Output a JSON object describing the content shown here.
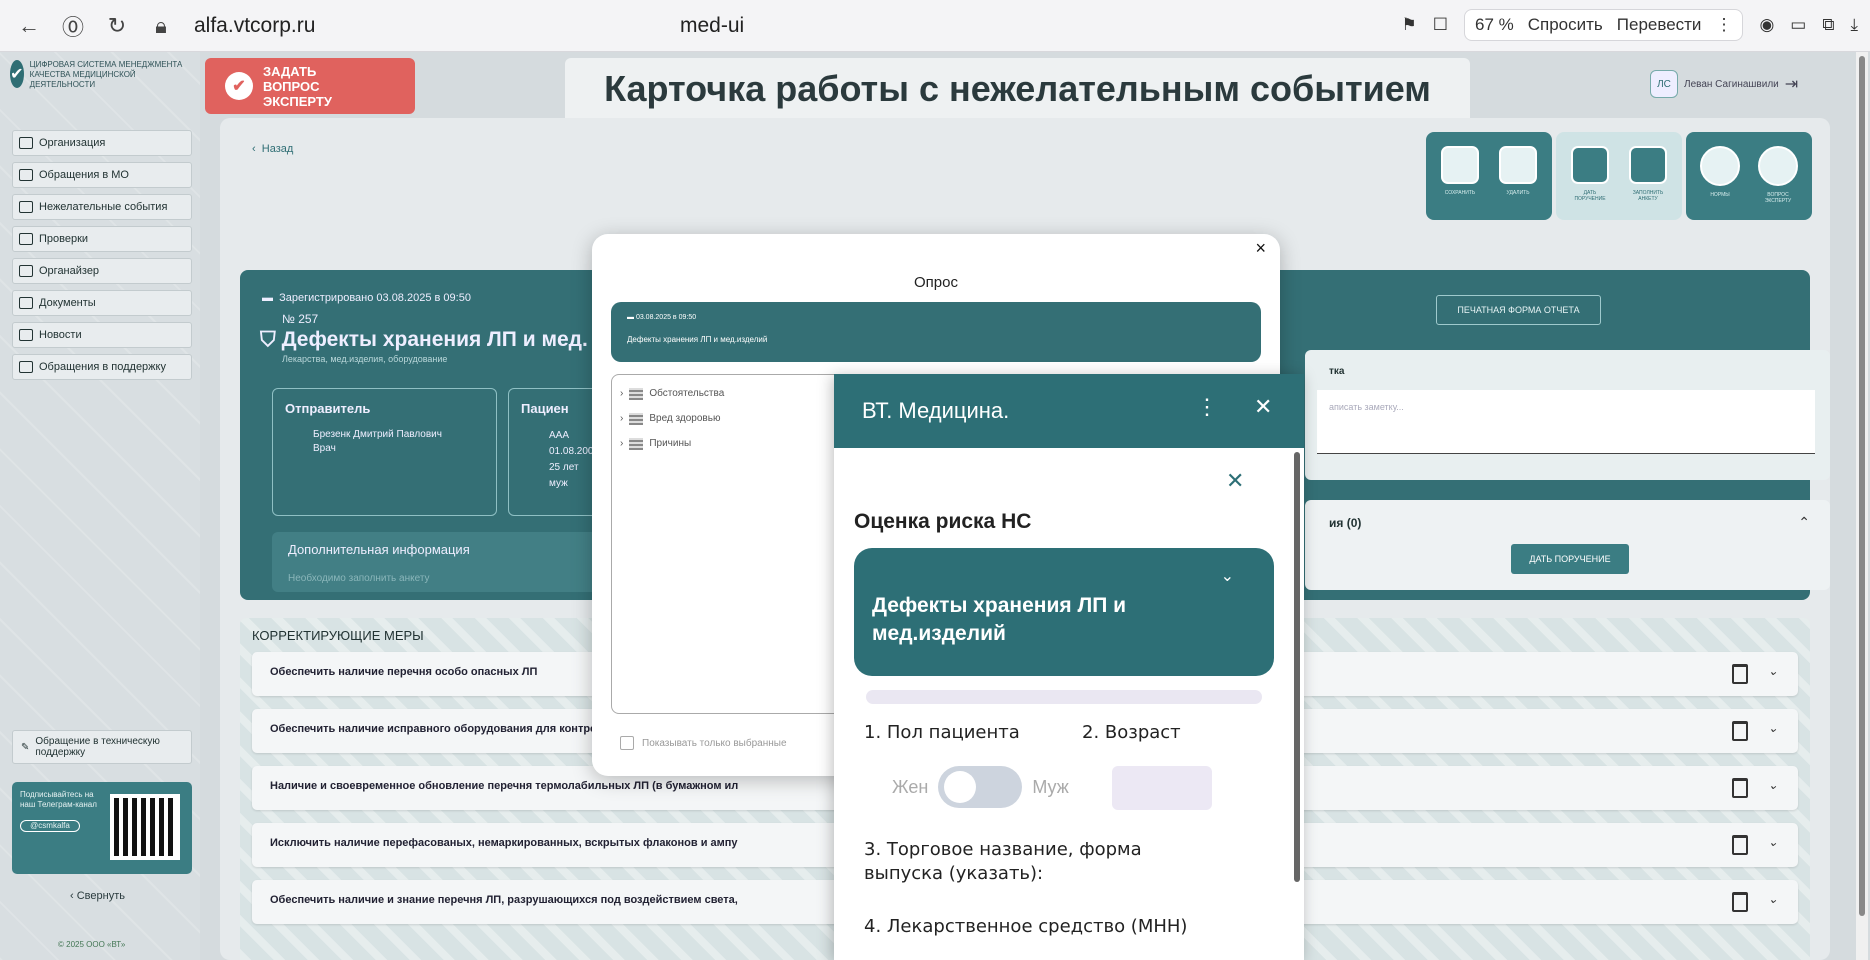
{
  "browser": {
    "url": "alfa.vtcorp.ru",
    "tab_title": "med-ui",
    "zoom": "67 %",
    "ask_label": "Спросить",
    "translate_label": "Перевести"
  },
  "sidebar": {
    "logo_text": "ЦИФРОВАЯ СИСТЕМА МЕНЕДЖМЕНТА КАЧЕСТВА МЕДИЦИНСКОЙ ДЕЯТЕЛЬНОСТИ",
    "items": [
      {
        "label": "Организация"
      },
      {
        "label": "Обращения в МО"
      },
      {
        "label": "Нежелательные события"
      },
      {
        "label": "Проверки"
      },
      {
        "label": "Органайзер"
      },
      {
        "label": "Документы"
      },
      {
        "label": "Новости"
      },
      {
        "label": "Обращения в поддержку"
      }
    ],
    "support_label": "Обращение в техническую поддержку",
    "subscribe_text": "Подписывайтесь на наш Телеграм-канал",
    "channel": "@csmkalfa",
    "collapse_label": "Свернуть",
    "copyright": "© 2025 ООО «ВТ»"
  },
  "header": {
    "ask_expert": "ЗАДАТЬ ВОПРОС ЭКСПЕРТУ",
    "page_title": "Карточка работы с нежелательным событием",
    "user_initials": "ЛС",
    "user_name": "Леван Сагинашвили"
  },
  "main": {
    "back_label": "Назад",
    "toolbar": [
      {
        "label": "СОХРАНИТЬ"
      },
      {
        "label": "УДАЛИТЬ"
      },
      {
        "label": "ДАТЬ ПОРУЧЕНИЕ"
      },
      {
        "label": "ЗАПОЛНИТЬ АНКЕТУ"
      },
      {
        "label": "НОРМЫ"
      },
      {
        "label": "ВОПРОС ЭКСПЕРТУ"
      }
    ],
    "event": {
      "registered": "Зарегистрировано 03.08.2025 в 09:50",
      "number": "№ 257",
      "title": "Дефекты хранения ЛП и мед.",
      "subtitle": "Лекарства, мед.изделия, оборудование",
      "sender_title": "Отправитель",
      "sender_name": "Брезенк Дмитрий Павлович",
      "sender_role": "Врач",
      "patient_title": "Пациен",
      "patient_name": "ААА",
      "patient_dob": "01.08.200",
      "patient_age": "25 лет",
      "patient_sex": "муж",
      "addinfo_title": "Дополнительная информация",
      "addinfo_text": "Необходимо заполнить анкету",
      "print_label": "ПЕЧАТНАЯ ФОРМА ОТЧЕТА",
      "note_title": "тка",
      "note_placeholder": "аписать заметку...",
      "assign_title": "ия (0)",
      "assign_button": "ДАТЬ ПОРУЧЕНИЕ"
    },
    "measures_title": "КОРРЕКТИРУЮЩИЕ МЕРЫ",
    "measures": [
      {
        "text": "Обеспечить наличие перечня особо опасных ЛП"
      },
      {
        "text": "Обеспечить наличие исправного оборудования для контроля параметров хранения"
      },
      {
        "text": "Наличие и своевременное обновление перечня термолабильных ЛП (в бумажном ил"
      },
      {
        "text": "Исключить наличие перефасованых, немаркированных, вскрытых флаконов и ампу"
      },
      {
        "text": "Обеспечить наличие и знание перечня ЛП, разрушающихся под воздействием света,"
      }
    ]
  },
  "survey": {
    "title": "Опрос",
    "head_date": "03.08.2025 в 09:50",
    "head_title": "Дефекты хранения ЛП и мед.изделий",
    "tree": [
      {
        "label": "Обстоятельства"
      },
      {
        "label": "Вред здоровью"
      },
      {
        "label": "Причины"
      }
    ],
    "show_selected": "Показывать только выбранные"
  },
  "widget": {
    "title": "ВТ. Медицина.",
    "heading": "Оценка риска НС",
    "card_title": "Дефекты хранения ЛП и мед.изделий",
    "q1": "1. Пол пациента",
    "q2": "2. Возраст",
    "sex_female": "Жен",
    "sex_male": "Муж",
    "q3": "3. Торговое название, форма выпуска (указать):",
    "q4": "4. Лекарственное средство (МНН)"
  },
  "colors": {
    "teal": "#346f75",
    "accent_red": "#e0625e"
  }
}
